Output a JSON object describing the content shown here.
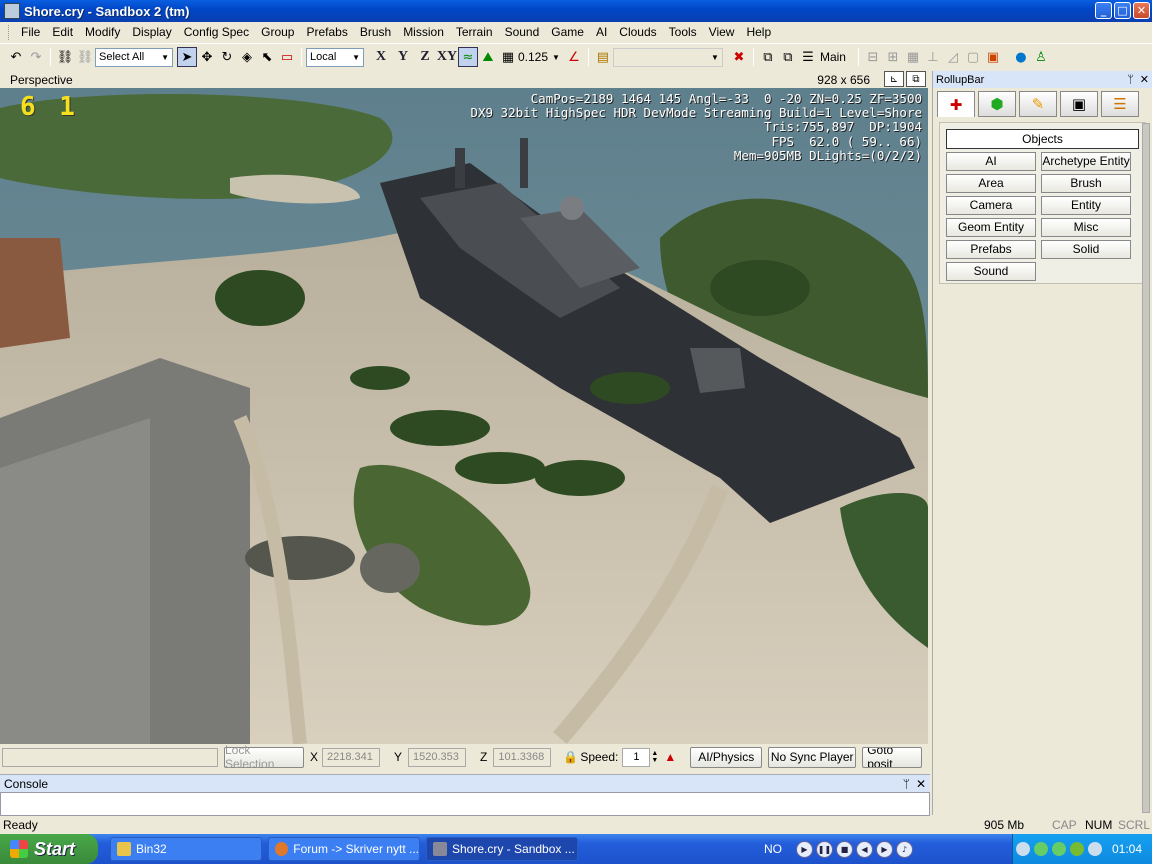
{
  "window": {
    "title": "Shore.cry - Sandbox 2 (tm)",
    "min": "_",
    "max": "□",
    "close": "✕"
  },
  "menu": [
    "File",
    "Edit",
    "Modify",
    "Display",
    "Config Spec",
    "Group",
    "Prefabs",
    "Brush",
    "Mission",
    "Terrain",
    "Sound",
    "Game",
    "AI",
    "Clouds",
    "Tools",
    "View",
    "Help"
  ],
  "toolbar": {
    "select_all": "Select All",
    "coord_system": "Local",
    "axis_x": "X",
    "axis_y": "Y",
    "axis_z": "Z",
    "axis_xy": "XY",
    "grid_value": "0.125",
    "layer": "Main"
  },
  "viewport": {
    "label": "Perspective",
    "size": "928 x 656",
    "fps_big": "6 1",
    "stats": "CamPos=2189 1464 145 Angl=-33  0 -20 ZN=0.25 ZF=3500\nDX9 32bit HighSpec HDR DevMode Streaming Build=1 Level=Shore\nTris:755,897  DP:1904\nFPS  62.0 ( 59.. 66)\nMem=905MB DLights=(0/2/2)"
  },
  "status_controls": {
    "lock_selection": "Lock Selection",
    "x_label": "X",
    "x_value": "2218.341",
    "y_label": "Y",
    "y_value": "1520.353",
    "z_label": "Z",
    "z_value": "101.3368",
    "speed_label": "Speed:",
    "speed_value": "1",
    "ai_physics": "AI/Physics",
    "no_sync": "No Sync Player",
    "goto": "Goto posit"
  },
  "console": {
    "title": "Console",
    "pin": "ᛘ",
    "close": "✕"
  },
  "statusbar": {
    "ready": "Ready",
    "memory": "905 Mb",
    "cap": "CAP",
    "num": "NUM",
    "scrl": "SCRL"
  },
  "rollup": {
    "title": "RollupBar",
    "pin": "ᛘ",
    "close": "✕",
    "objects_header": "Objects",
    "buttons": [
      "AI",
      "Archetype Entity",
      "Area",
      "Brush",
      "Camera",
      "Entity",
      "Geom Entity",
      "Misc",
      "Prefabs",
      "Solid",
      "Sound"
    ]
  },
  "taskbar": {
    "start": "Start",
    "tasks": [
      {
        "label": "Bin32",
        "color": "#e8c44a"
      },
      {
        "label": "Forum -> Skriver nytt ...",
        "color": "#e0782a"
      },
      {
        "label": "Shore.cry - Sandbox ...",
        "color": "#889"
      }
    ],
    "lang": "NO",
    "clock": "01:04"
  }
}
